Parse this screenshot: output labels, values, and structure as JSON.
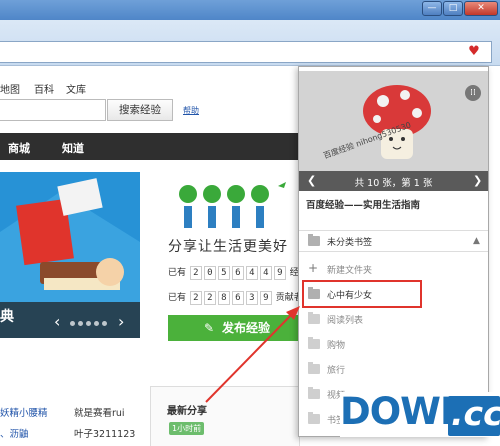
{
  "browser": {
    "min_glyph": "—",
    "max_glyph": "□",
    "close_glyph": "✕",
    "bookmark_glyph": "♥"
  },
  "page": {
    "top_links": [
      "地图",
      "百科",
      "文库"
    ],
    "search_button": "搜索经验",
    "help_link": "帮助",
    "nav_items": [
      "商城",
      "知道"
    ],
    "banner_text": "典",
    "slogan": "分享让生活更美好",
    "stat1_prefix": "已有",
    "stat1_digits": [
      "2",
      "0",
      "5",
      "6",
      "4",
      "4",
      "9"
    ],
    "stat1_suffix": "经",
    "stat2_prefix": "已有",
    "stat2_digits": [
      "2",
      "2",
      "8",
      "6",
      "3",
      "9"
    ],
    "stat2_suffix": "贡献者",
    "publish_button": "发布经验",
    "bottom_texts": [
      "妖精小腰精",
      "就是赛看rui",
      "、沥鼬",
      "叶子3211123"
    ],
    "latest_share_title": "最新分享",
    "time_tag": "1小时前"
  },
  "popup": {
    "grid_icon": "⁞⁞",
    "watermark": "百度经验 nihong530530",
    "pager_text": "共 10 张，第 1 张",
    "pager_prev": "❮",
    "pager_next": "❯",
    "page_title": "百度经验——实用生活指南",
    "default_folder": "未分类书签",
    "collapse_glyph": "▲",
    "new_folder": "新建文件夹",
    "folders": [
      "心中有少女",
      "阅读列表",
      "购物",
      "旅行",
      "视频",
      "书签"
    ]
  },
  "logo": {
    "word": "DOWN",
    "suffix": ".cc"
  },
  "colors": {
    "highlight": "#e0342c",
    "brand_blue": "#1c6fb5",
    "publish_green": "#4bb13b"
  }
}
